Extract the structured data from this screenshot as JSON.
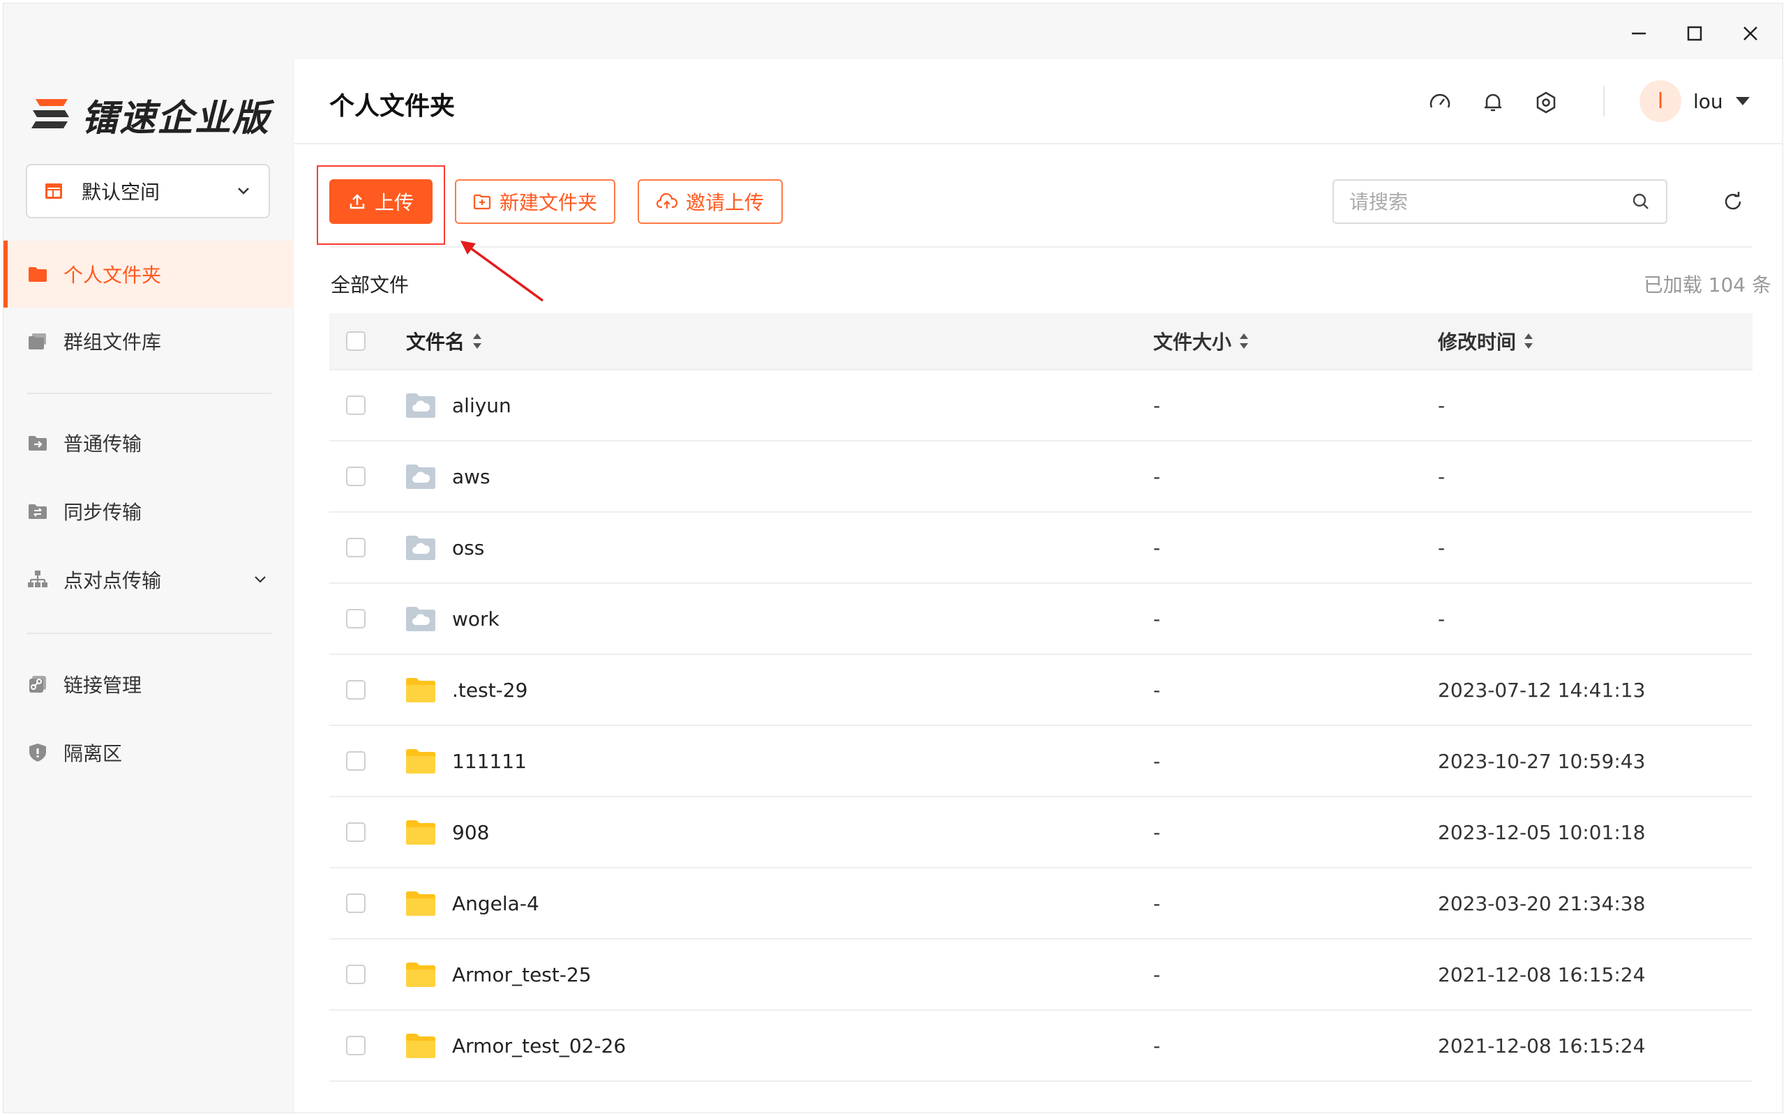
{
  "app": {
    "logo_text": "镭速企业版",
    "colors": {
      "accent": "#ff5a1f",
      "highlight": "#ff3b30",
      "cloud_folder": "#c2ccd6",
      "folder": "#ffc21a"
    }
  },
  "sidebar": {
    "space_select": {
      "label": "默认空间"
    },
    "items": [
      {
        "label": "个人文件夹",
        "icon": "folder-icon",
        "active": true
      },
      {
        "label": "群组文件库",
        "icon": "group-folder-icon"
      },
      {
        "label": "普通传输",
        "icon": "transfer-icon"
      },
      {
        "label": "同步传输",
        "icon": "sync-icon"
      },
      {
        "label": "点对点传输",
        "icon": "p2p-icon"
      },
      {
        "label": "链接管理",
        "icon": "link-icon"
      },
      {
        "label": "隔离区",
        "icon": "shield-icon"
      }
    ]
  },
  "header": {
    "title": "个人文件夹",
    "user": {
      "avatar_letter": "l",
      "name": "lou"
    }
  },
  "toolbar": {
    "upload_label": "上传",
    "new_folder_label": "新建文件夹",
    "invite_upload_label": "邀请上传",
    "search_placeholder": "请搜索"
  },
  "list": {
    "section_title": "全部文件",
    "loaded_count": "已加载 104 条",
    "columns": {
      "name": "文件名",
      "size": "文件大小",
      "modified": "修改时间"
    },
    "rows": [
      {
        "name": "aliyun",
        "type": "cloud-folder",
        "size": "-",
        "modified": "-"
      },
      {
        "name": "aws",
        "type": "cloud-folder",
        "size": "-",
        "modified": "-"
      },
      {
        "name": "oss",
        "type": "cloud-folder",
        "size": "-",
        "modified": "-"
      },
      {
        "name": "work",
        "type": "cloud-folder",
        "size": "-",
        "modified": "-"
      },
      {
        "name": ".test-29",
        "type": "folder",
        "size": "-",
        "modified": "2023-07-12 14:41:13"
      },
      {
        "name": "111111",
        "type": "folder",
        "size": "-",
        "modified": "2023-10-27 10:59:43"
      },
      {
        "name": "908",
        "type": "folder",
        "size": "-",
        "modified": "2023-12-05 10:01:18"
      },
      {
        "name": "Angela-4",
        "type": "folder",
        "size": "-",
        "modified": "2023-03-20 21:34:38"
      },
      {
        "name": "Armor_test-25",
        "type": "folder",
        "size": "-",
        "modified": "2021-12-08 16:15:24"
      },
      {
        "name": "Armor_test_02-26",
        "type": "folder",
        "size": "-",
        "modified": "2021-12-08 16:15:24"
      }
    ]
  }
}
